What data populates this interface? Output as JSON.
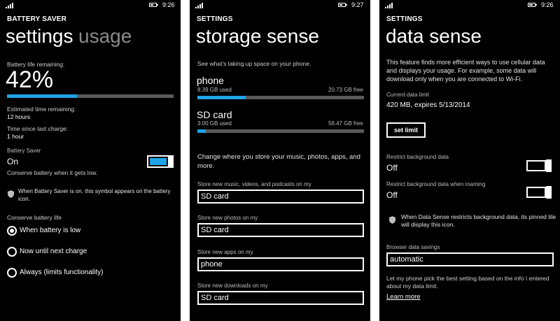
{
  "battery": {
    "status": {
      "time": "9:26"
    },
    "app_title": "BATTERY SAVER",
    "pivot": {
      "active": "settings",
      "inactive": "usage"
    },
    "life_label": "Battery life remaining:",
    "percent_text": "42%",
    "percent_value": 0.42,
    "estimated_label": "Estimated time remaining:",
    "estimated_value": "12 hours",
    "since_label": "Time since last charge:",
    "since_value": "1 hour",
    "saver_label": "Battery Saver",
    "saver_state": "On",
    "saver_desc": "Conserve battery when it gets low.",
    "symbol_note": "When Battery Saver is on, this symbol appears on the battery icon.",
    "conserve_label": "Conserve battery life",
    "options": [
      "When battery is low",
      "Now until next charge",
      "Always (limits functionality)"
    ],
    "selected_option": "When battery is low"
  },
  "storage": {
    "status": {
      "time": "9:27"
    },
    "app_title": "SETTINGS",
    "page_title": "storage sense",
    "intro": "See what's taking up space on your phone.",
    "phone": {
      "name": "phone",
      "used": "8.39 GB used",
      "free": "20.73 GB free",
      "fill": 0.29
    },
    "sd": {
      "name": "SD card",
      "used": "3.00 GB used",
      "free": "56.47 GB free",
      "fill": 0.05
    },
    "change_text": "Change where you store your music, photos, apps, and more.",
    "fields": [
      {
        "label": "Store new music, videos, and podcasts on my",
        "value": "SD card"
      },
      {
        "label": "Store new photos on my",
        "value": "SD card"
      },
      {
        "label": "Store new apps on my",
        "value": "phone"
      },
      {
        "label": "Store new downloads on my",
        "value": "SD card"
      }
    ]
  },
  "data": {
    "status": {
      "time": "9:26"
    },
    "app_title": "SETTINGS",
    "page_title": "data sense",
    "intro": "This feature finds more efficient ways to use cellular data and displays your usage. For example, some data will download only when you are connected to Wi-Fi.",
    "limit_label": "Current data limit",
    "limit_value": "420 MB, expires 5/13/2014",
    "set_limit_button": "set limit",
    "restrict_bg_label": "Restrict background data",
    "restrict_bg_state": "Off",
    "restrict_roam_label": "Restrict background data when roaming",
    "restrict_roam_state": "Off",
    "pinned_note": "When Data Sense restricts background data, its pinned tile will display this icon.",
    "browser_label": "Browser data savings",
    "browser_value": "automatic",
    "pick_note": "Let my phone pick the best setting based on the info I entered about my data limit.",
    "learn_more": "Learn more"
  }
}
